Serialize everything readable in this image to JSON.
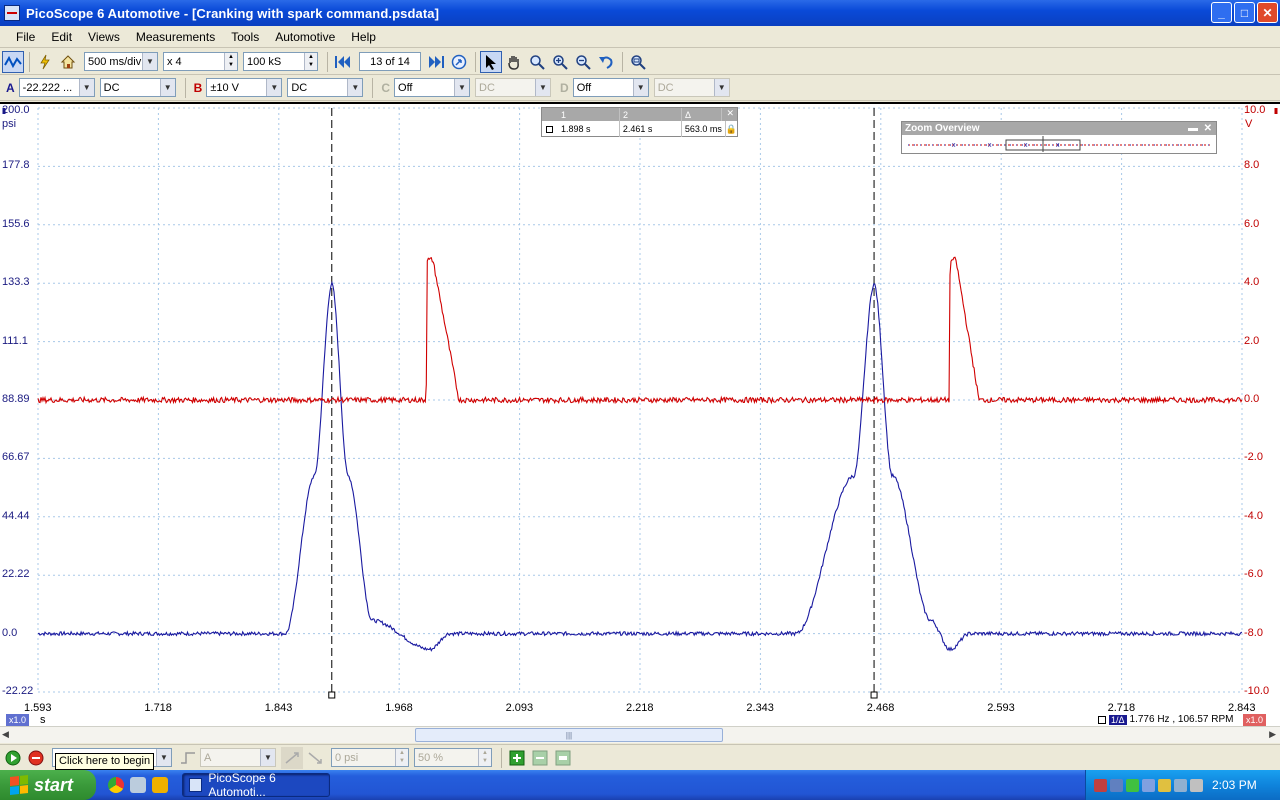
{
  "window": {
    "title": "PicoScope 6 Automotive - [Cranking with spark command.psdata]",
    "min": "_",
    "max": "□",
    "close": "✕"
  },
  "menu": [
    "File",
    "Edit",
    "Views",
    "Measurements",
    "Tools",
    "Automotive",
    "Help"
  ],
  "toolbar1": {
    "timebase": "500 ms/div",
    "zoom": "x 4",
    "samples": "100 kS",
    "page": "13",
    "page_total": "of 14"
  },
  "toolbar2": {
    "chA": {
      "label": "A",
      "range": "-22.222 ...",
      "coupling": "DC"
    },
    "chB": {
      "label": "B",
      "range": "±10 V",
      "coupling": "DC"
    },
    "chC": {
      "label": "C",
      "range": "Off",
      "coupling": "DC"
    },
    "chD": {
      "label": "D",
      "range": "Off",
      "coupling": "DC"
    }
  },
  "left_axis": {
    "unit": "psi",
    "ticks": [
      "200.0",
      "177.8",
      "155.6",
      "133.3",
      "111.1",
      "88.89",
      "66.67",
      "44.44",
      "22.22",
      "0.0",
      "-22.22"
    ]
  },
  "right_axis": {
    "unit": "V",
    "ticks": [
      "10.0",
      "8.0",
      "6.0",
      "4.0",
      "2.0",
      "0.0",
      "-2.0",
      "-4.0",
      "-6.0",
      "-8.0",
      "-10.0"
    ]
  },
  "x_axis": {
    "unit": "s",
    "ticks": [
      "1.593",
      "1.718",
      "1.843",
      "1.968",
      "2.093",
      "2.218",
      "2.343",
      "2.468",
      "2.593",
      "2.718",
      "2.843"
    ]
  },
  "measurements": {
    "headers": [
      "1",
      "2",
      "Δ"
    ],
    "values": [
      "1.898 s",
      "2.461 s",
      "563.0 ms"
    ]
  },
  "zoom_overview": {
    "title": "Zoom Overview"
  },
  "scale_tags": {
    "left": "x1.0",
    "right": "x1.0"
  },
  "frequency_readout": "1.776 Hz , 106.57 RPM",
  "bottom": {
    "tooltip": "Click here to begin",
    "trigger_channel": "A",
    "trigger_level": "0 psi",
    "pretrigger": "50 %"
  },
  "chart_data": {
    "type": "line",
    "x_range": [
      1.593,
      2.843
    ],
    "series": [
      {
        "axis": "left",
        "color": "#1a1aa0",
        "x": [
          1.593,
          1.85,
          1.88,
          1.898,
          1.915,
          1.94,
          2.0,
          2.02,
          2.38,
          2.44,
          2.461,
          2.48,
          2.52,
          2.54,
          2.56,
          2.843
        ],
        "values": [
          0,
          0,
          60,
          133,
          60,
          5,
          -6,
          0,
          0,
          60,
          133,
          60,
          5,
          -6,
          0,
          0
        ]
      },
      {
        "axis": "right",
        "color": "#d00000",
        "x": [
          1.593,
          1.996,
          1.997,
          2.003,
          2.03,
          2.539,
          2.54,
          2.546,
          2.57,
          2.843
        ],
        "values": [
          0,
          0,
          4.8,
          4.8,
          0,
          0,
          4.8,
          4.8,
          0,
          0
        ]
      }
    ],
    "cursors_x": [
      1.898,
      2.461
    ],
    "left_ylim": [
      -22.22,
      200.0
    ],
    "right_ylim": [
      -10.0,
      10.0
    ],
    "grid": true
  },
  "taskbar": {
    "start": "start",
    "task": "PicoScope 6 Automoti...",
    "clock": "2:03 PM"
  }
}
